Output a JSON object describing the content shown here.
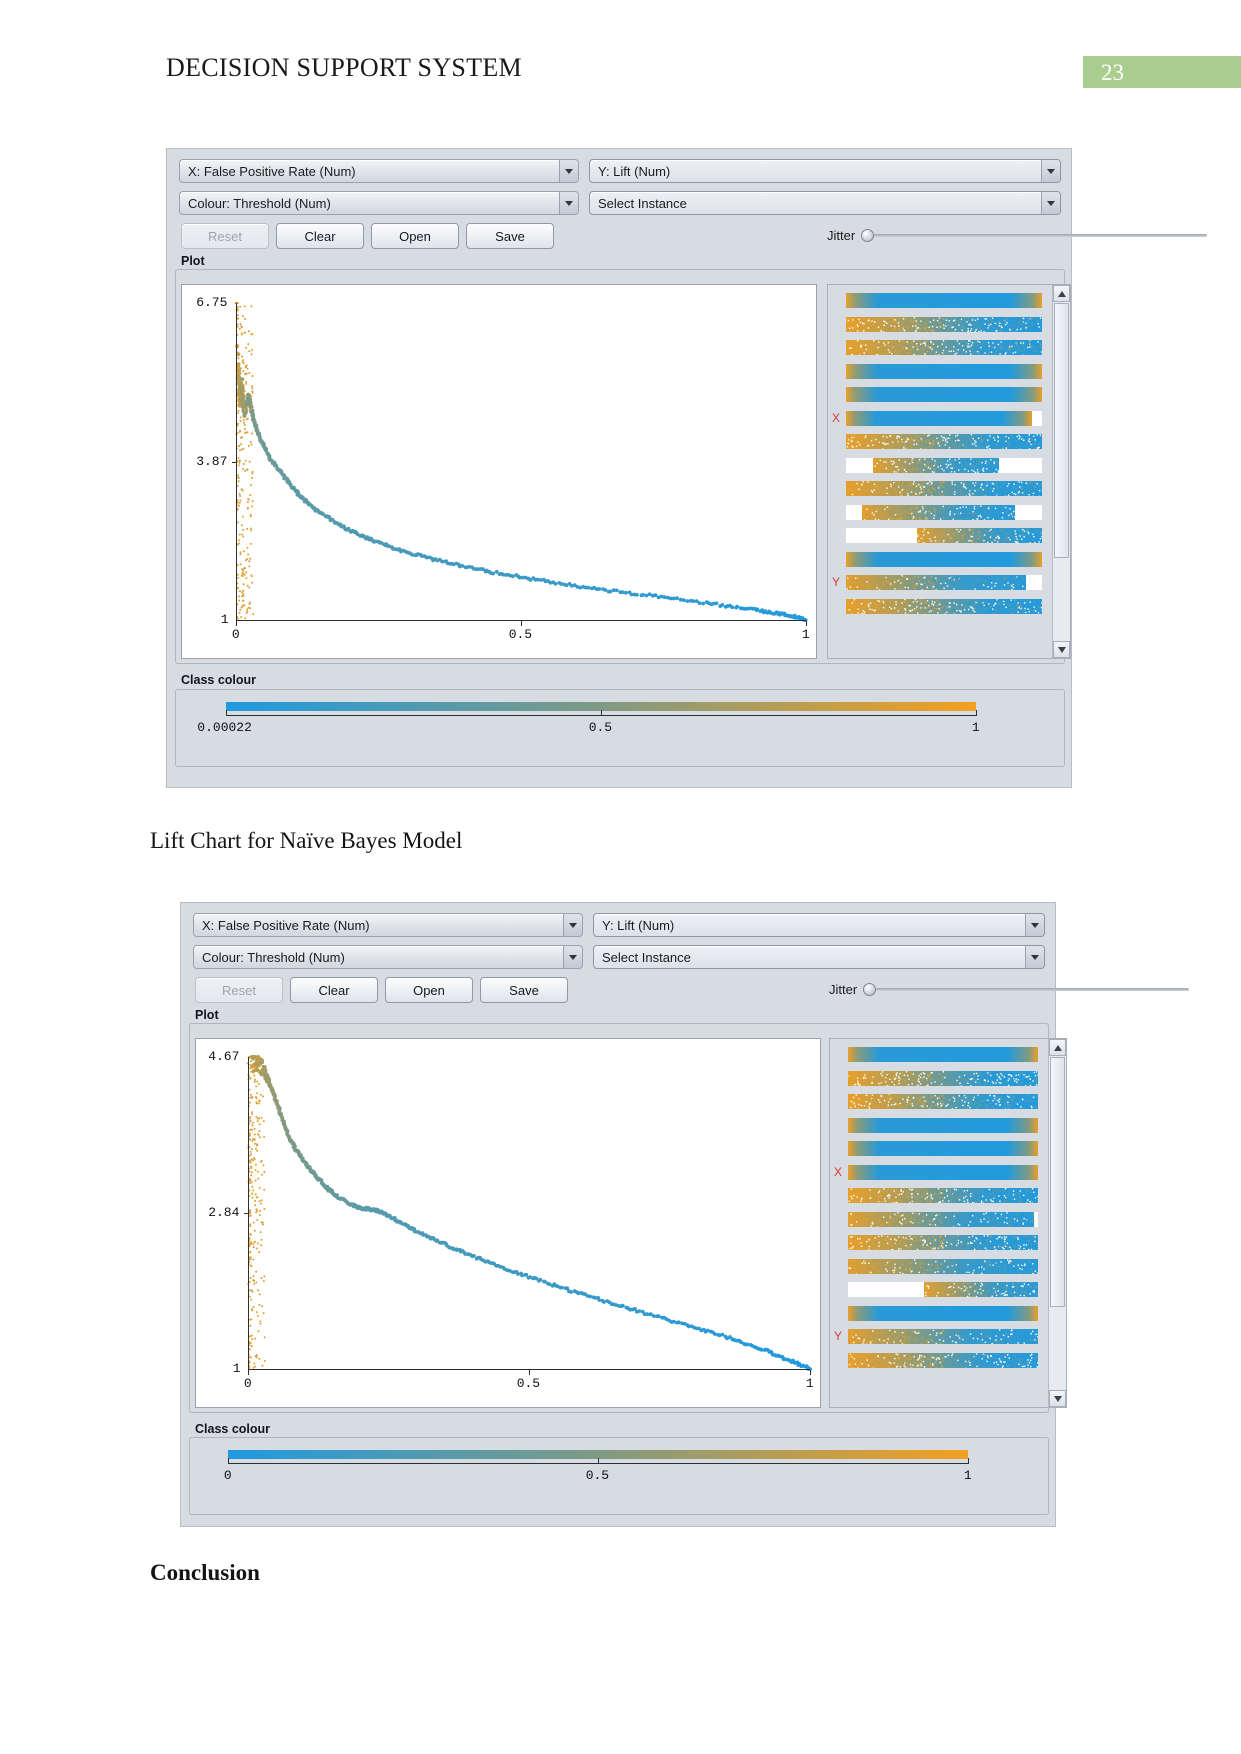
{
  "document": {
    "header_title": "DECISION SUPPORT SYSTEM",
    "page_number": "23",
    "page_badge_color": "#a9ce8f",
    "caption_1": "Lift Chart for Naïve Bayes Model",
    "caption_2": "Conclusion"
  },
  "panel1": {
    "x_attribute": "X: False Positive Rate (Num)",
    "y_attribute": "Y: Lift (Num)",
    "colour_attribute": "Colour: Threshold (Num)",
    "instance_selector": "Select Instance",
    "buttons": {
      "reset": "Reset",
      "clear": "Clear",
      "open": "Open",
      "save": "Save"
    },
    "jitter_label": "Jitter",
    "plot_group_label": "Plot",
    "class_colour_label": "Class colour",
    "attr_marks": {
      "x": "X",
      "y": "Y"
    },
    "legend_ticks": [
      "0.00022",
      "0.5",
      "1"
    ]
  },
  "panel2": {
    "x_attribute": "X: False Positive Rate (Num)",
    "y_attribute": "Y: Lift (Num)",
    "colour_attribute": "Colour: Threshold (Num)",
    "instance_selector": "Select Instance",
    "buttons": {
      "reset": "Reset",
      "clear": "Clear",
      "open": "Open",
      "save": "Save"
    },
    "jitter_label": "Jitter",
    "plot_group_label": "Plot",
    "class_colour_label": "Class colour",
    "attr_marks": {
      "x": "X",
      "y": "Y"
    },
    "legend_ticks": [
      "0",
      "0.5",
      "1"
    ]
  },
  "chart_data": [
    {
      "type": "scatter",
      "title": "Lift Chart for Naïve Bayes Model",
      "xlabel": "False Positive Rate",
      "ylabel": "Lift",
      "xlim": [
        0,
        1
      ],
      "ylim": [
        1,
        6.75
      ],
      "xticks": [
        "0",
        "0.5",
        "1"
      ],
      "xtick_values": [
        0,
        0.5,
        1
      ],
      "yticks": [
        "6.75",
        "3.87",
        "1"
      ],
      "ytick_values": [
        6.75,
        3.87,
        1
      ],
      "colour_by": "Threshold",
      "colour_scale": {
        "low": "#1f9ae0",
        "mid": "#7f9a84",
        "high": "#f2a021"
      },
      "colourbar_ticks": [
        "0.00022",
        "0.5",
        "1"
      ],
      "grid": false,
      "legend": "none",
      "x": [
        0.0,
        0.002,
        0.004,
        0.006,
        0.008,
        0.01,
        0.012,
        0.015,
        0.018,
        0.022,
        0.026,
        0.032,
        0.04,
        0.05,
        0.062,
        0.078,
        0.095,
        0.115,
        0.14,
        0.17,
        0.205,
        0.245,
        0.29,
        0.34,
        0.395,
        0.455,
        0.52,
        0.59,
        0.665,
        0.745,
        0.83,
        0.9,
        0.95,
        0.98,
        1.0
      ],
      "y": [
        6.75,
        6.1,
        5.55,
        5.2,
        4.95,
        5.3,
        5.05,
        4.7,
        4.9,
        5.1,
        4.85,
        4.6,
        4.35,
        4.12,
        3.9,
        3.68,
        3.45,
        3.22,
        3.0,
        2.8,
        2.6,
        2.42,
        2.26,
        2.12,
        1.98,
        1.86,
        1.74,
        1.63,
        1.52,
        1.42,
        1.3,
        1.2,
        1.12,
        1.06,
        1.0
      ]
    },
    {
      "type": "scatter",
      "title": "Lift Chart (second model)",
      "xlabel": "False Positive Rate",
      "ylabel": "Lift",
      "xlim": [
        0,
        1
      ],
      "ylim": [
        1,
        4.67
      ],
      "xticks": [
        "0",
        "0.5",
        "1"
      ],
      "xtick_values": [
        0,
        0.5,
        1
      ],
      "yticks": [
        "4.67",
        "2.84",
        "1"
      ],
      "ytick_values": [
        4.67,
        2.84,
        1
      ],
      "colour_by": "Threshold",
      "colour_scale": {
        "low": "#1f9ae0",
        "mid": "#7f9a84",
        "high": "#f2a021"
      },
      "colourbar_ticks": [
        "0",
        "0.5",
        "1"
      ],
      "grid": false,
      "legend": "none",
      "x": [
        0.0,
        0.004,
        0.01,
        0.016,
        0.024,
        0.032,
        0.042,
        0.052,
        0.062,
        0.074,
        0.088,
        0.104,
        0.122,
        0.142,
        0.166,
        0.194,
        0.215,
        0.232,
        0.262,
        0.3,
        0.345,
        0.395,
        0.45,
        0.51,
        0.575,
        0.645,
        0.715,
        0.79,
        0.86,
        0.92,
        0.965,
        1.0
      ],
      "y": [
        4.3,
        4.6,
        4.67,
        4.62,
        4.55,
        4.45,
        4.3,
        4.12,
        3.92,
        3.72,
        3.55,
        3.4,
        3.26,
        3.12,
        3.0,
        2.9,
        2.88,
        2.86,
        2.76,
        2.62,
        2.48,
        2.34,
        2.2,
        2.06,
        1.92,
        1.78,
        1.64,
        1.5,
        1.36,
        1.22,
        1.1,
        1.0
      ]
    }
  ],
  "attr_bars_panel1": [
    {
      "fill_start": 0,
      "fill_end": 100,
      "speckle": "low"
    },
    {
      "fill_start": 0,
      "fill_end": 100,
      "speckle": "high"
    },
    {
      "fill_start": 0,
      "fill_end": 100,
      "speckle": "high"
    },
    {
      "fill_start": 0,
      "fill_end": 100,
      "speckle": "low"
    },
    {
      "fill_start": 0,
      "fill_end": 100,
      "speckle": "low"
    },
    {
      "fill_start": 0,
      "fill_end": 95,
      "speckle": "low"
    },
    {
      "fill_start": 0,
      "fill_end": 100,
      "speckle": "high"
    },
    {
      "fill_start": 14,
      "fill_end": 78,
      "speckle": "mid"
    },
    {
      "fill_start": 0,
      "fill_end": 100,
      "speckle": "high"
    },
    {
      "fill_start": 8,
      "fill_end": 86,
      "speckle": "mid"
    },
    {
      "fill_start": 36,
      "fill_end": 100,
      "speckle": "mid"
    },
    {
      "fill_start": 0,
      "fill_end": 100,
      "speckle": "low"
    },
    {
      "fill_start": 0,
      "fill_end": 92,
      "speckle": "mid"
    },
    {
      "fill_start": 0,
      "fill_end": 100,
      "speckle": "high"
    }
  ],
  "attr_bars_panel2": [
    {
      "fill_start": 0,
      "fill_end": 100,
      "speckle": "low"
    },
    {
      "fill_start": 0,
      "fill_end": 100,
      "speckle": "high"
    },
    {
      "fill_start": 0,
      "fill_end": 100,
      "speckle": "high"
    },
    {
      "fill_start": 0,
      "fill_end": 100,
      "speckle": "low"
    },
    {
      "fill_start": 0,
      "fill_end": 100,
      "speckle": "low"
    },
    {
      "fill_start": 0,
      "fill_end": 100,
      "speckle": "low"
    },
    {
      "fill_start": 0,
      "fill_end": 100,
      "speckle": "high"
    },
    {
      "fill_start": 0,
      "fill_end": 98,
      "speckle": "mid"
    },
    {
      "fill_start": 0,
      "fill_end": 100,
      "speckle": "high"
    },
    {
      "fill_start": 0,
      "fill_end": 100,
      "speckle": "mid"
    },
    {
      "fill_start": 40,
      "fill_end": 100,
      "speckle": "mid"
    },
    {
      "fill_start": 0,
      "fill_end": 100,
      "speckle": "low"
    },
    {
      "fill_start": 0,
      "fill_end": 100,
      "speckle": "mid"
    },
    {
      "fill_start": 0,
      "fill_end": 100,
      "speckle": "high"
    }
  ]
}
